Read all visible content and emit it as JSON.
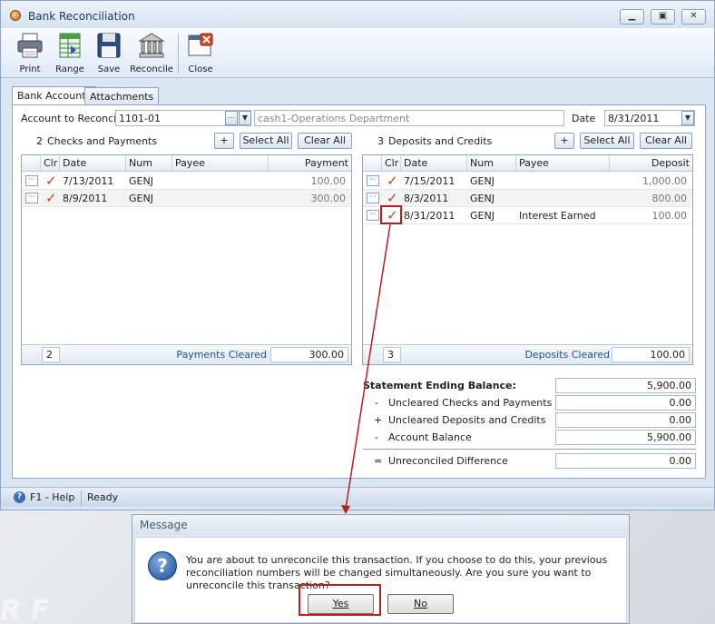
{
  "window": {
    "title": "Bank Reconciliation",
    "controls": [
      "minimize",
      "restore",
      "close"
    ]
  },
  "toolbar": {
    "items": [
      {
        "label": "Print",
        "icon": "printer-icon"
      },
      {
        "label": "Range",
        "icon": "range-icon"
      },
      {
        "label": "Save",
        "icon": "save-icon"
      },
      {
        "label": "Reconcile",
        "icon": "bank-icon"
      },
      {
        "label": "Close",
        "icon": "close-window-icon"
      }
    ]
  },
  "tabs": [
    {
      "label": "Bank Accounts",
      "active": true
    },
    {
      "label": "Attachments",
      "active": false
    }
  ],
  "account": {
    "label": "Account to Reconcile",
    "value": "1101-01",
    "description": "cash1-Operations Department",
    "date_label": "Date",
    "date_value": "8/31/2011"
  },
  "checks": {
    "count": "2",
    "title": "Checks and Payments",
    "add_label": "+",
    "select_all": "Select All",
    "clear_all": "Clear All",
    "columns": [
      "Clr",
      "Date",
      "Num",
      "Payee",
      "Payment"
    ],
    "rows": [
      {
        "cleared": true,
        "date": "7/13/2011",
        "num": "GENJ",
        "payee": "",
        "amount": "100.00"
      },
      {
        "cleared": true,
        "date": "8/9/2011",
        "num": "GENJ",
        "payee": "",
        "amount": "300.00"
      }
    ],
    "footer_count": "2",
    "footer_label": "Payments Cleared",
    "footer_total": "300.00"
  },
  "deposits": {
    "count": "3",
    "title": "Deposits and Credits",
    "add_label": "+",
    "select_all": "Select All",
    "clear_all": "Clear All",
    "columns": [
      "Clr",
      "Date",
      "Num",
      "Payee",
      "Deposit"
    ],
    "rows": [
      {
        "cleared": true,
        "date": "7/15/2011",
        "num": "GENJ",
        "payee": "",
        "amount": "1,000.00"
      },
      {
        "cleared": true,
        "date": "8/3/2011",
        "num": "GENJ",
        "payee": "",
        "amount": "800.00"
      },
      {
        "cleared": true,
        "date": "8/31/2011",
        "num": "GENJ",
        "payee": "Interest Earned",
        "amount": "100.00"
      }
    ],
    "footer_count": "3",
    "footer_label": "Deposits Cleared",
    "footer_total": "100.00"
  },
  "summary": {
    "statement_label": "Statement Ending Balance:",
    "statement_value": "5,900.00",
    "lines": [
      {
        "sign": "-",
        "label": "Uncleared Checks and Payments",
        "value": "0.00"
      },
      {
        "sign": "+",
        "label": "Uncleared Deposits and Credits",
        "value": "0.00"
      },
      {
        "sign": "-",
        "label": "Account Balance",
        "value": "5,900.00"
      }
    ],
    "difference_sign": "=",
    "difference_label": "Unreconciled Difference",
    "difference_value": "0.00"
  },
  "status": {
    "help": "F1 - Help",
    "state": "Ready"
  },
  "dialog": {
    "title": "Message",
    "message": "You are about to unreconcile this transaction. If you choose to do this, your previous reconciliation numbers will be changed simultaneously. Are you sure you want to unreconcile this transaction?",
    "yes": "Yes",
    "no": "No"
  },
  "watermark": "R F",
  "colors": {
    "check_mark": "#d2421a",
    "annotation": "#b41f1f",
    "link_blue": "#1a52a0"
  }
}
